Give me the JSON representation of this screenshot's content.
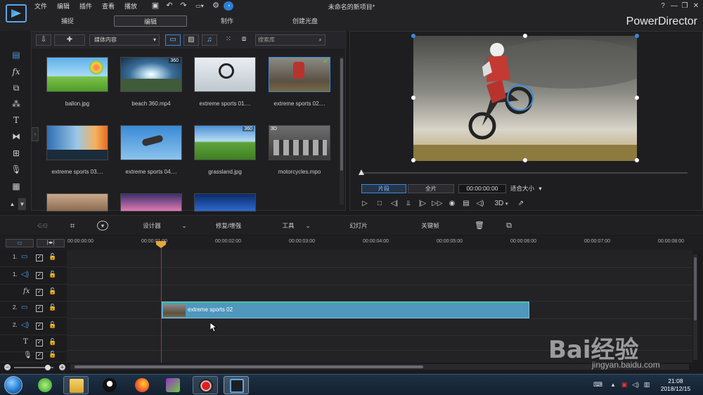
{
  "menu": {
    "items": [
      "文件",
      "编辑",
      "插件",
      "查看",
      "播放"
    ],
    "document_title": "未命名的新项目*"
  },
  "mode_tabs": [
    {
      "label": "捕捉"
    },
    {
      "label": "编辑",
      "active": true
    },
    {
      "label": "制作"
    },
    {
      "label": "创建光盘"
    }
  ],
  "brand": "PowerDirector",
  "window_controls": [
    "?",
    "—",
    "❐",
    "✕"
  ],
  "library": {
    "dropdown_value": "媒体内容",
    "search_placeholder": "搜索库",
    "items": [
      {
        "caption": "ballon.jpg",
        "badge": ""
      },
      {
        "caption": "beach 360.mp4",
        "badge": "360"
      },
      {
        "caption": "extreme sports 01....",
        "badge": ""
      },
      {
        "caption": "extreme sports 02....",
        "badge": "check"
      },
      {
        "caption": "extreme sports 03....",
        "badge": ""
      },
      {
        "caption": "extreme sports 04....",
        "badge": ""
      },
      {
        "caption": "grassland.jpg",
        "badge": "360"
      },
      {
        "caption": "motorcycles.mpo",
        "badge": "3D"
      }
    ]
  },
  "preview": {
    "segment_clip": "片段",
    "segment_full": "全片",
    "timecode": "00:00:00:00",
    "fit": "适合大小",
    "mode_3d": "3D"
  },
  "timeline_toolbar": {
    "designer": "设计器",
    "fix_enhance": "修复/增强",
    "tools": "工具",
    "slideshow": "幻灯片",
    "keyframe": "关键帧"
  },
  "ruler": [
    "00:00:00:00",
    "00:00:01:00",
    "00:00:02:00",
    "00:00:03:00",
    "00:00:04:00",
    "00:00:05:00",
    "00:00:06:00",
    "00:00:07:00",
    "00:00:08:00"
  ],
  "tracks": [
    {
      "label": "1.",
      "icon": "video-track-icon"
    },
    {
      "label": "1.",
      "icon": "audio-track-icon"
    },
    {
      "label": "",
      "icon": "fx-track-icon"
    },
    {
      "label": "2.",
      "icon": "video-track-icon"
    },
    {
      "label": "2.",
      "icon": "audio-track-icon"
    },
    {
      "label": "",
      "icon": "title-track-icon"
    },
    {
      "label": "",
      "icon": "voice-track-icon"
    }
  ],
  "clip": {
    "label": "extreme sports 02"
  },
  "taskbar": {
    "time": "21:08",
    "date": "2018/12/15"
  },
  "watermark": {
    "text": "Bai经验",
    "sub": "jingyan.baidu.com"
  },
  "colors": {
    "accent": "#3d89d8",
    "clip": "#4f97bd",
    "playhead": "#c02a2a"
  }
}
